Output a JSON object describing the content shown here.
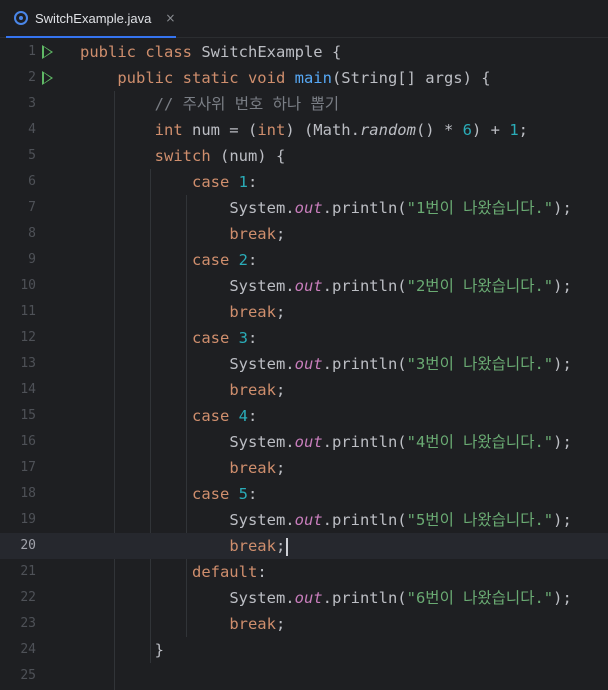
{
  "tab": {
    "file_name": "SwitchExample.java",
    "close_glyph": "×",
    "icon": "java-class-icon"
  },
  "editor": {
    "current_line": 20,
    "line_numbers": [
      "1",
      "2",
      "3",
      "4",
      "5",
      "6",
      "7",
      "8",
      "9",
      "10",
      "11",
      "12",
      "13",
      "14",
      "15",
      "16",
      "17",
      "18",
      "19",
      "20",
      "21",
      "22",
      "23",
      "24",
      "25"
    ],
    "code": {
      "l1_kw": "public class ",
      "l1_rest": "SwitchExample {",
      "l2_kw": "public static void ",
      "l2_fn": "main",
      "l2_rest": "(String[] args) {",
      "l3_comment": "// 주사위 번호 하나 뽑기",
      "l4_kw1": "int ",
      "l4_a": "num = (",
      "l4_kw2": "int",
      "l4_b": ") (Math.",
      "l4_it": "random",
      "l4_c": "() * ",
      "l4_n1": "6",
      "l4_d": ") + ",
      "l4_n2": "1",
      "l4_e": ";",
      "l5_kw": "switch ",
      "l5_rest": "(num) {",
      "case_kw": "case ",
      "colon": ":",
      "system": "System.",
      "out": "out",
      "println_open": ".println(",
      "println_close": ");",
      "break_kw": "break",
      "semi": ";",
      "default_kw": "default",
      "close_brace": "}",
      "cases": [
        "1",
        "2",
        "3",
        "4",
        "5"
      ],
      "messages": [
        "\"1번이 나왔습니다.\"",
        "\"2번이 나왔습니다.\"",
        "\"3번이 나왔습니다.\"",
        "\"4번이 나왔습니다.\"",
        "\"5번이 나왔습니다.\"",
        "\"6번이 나왔습니다.\""
      ]
    }
  },
  "colors": {
    "background": "#1e1f22",
    "keyword": "#cf8e6d",
    "function": "#56a8f5",
    "number": "#2aacb8",
    "string": "#6aab73",
    "comment": "#7a7e85",
    "field": "#c77dbb",
    "run_gutter": "#5fb865"
  }
}
